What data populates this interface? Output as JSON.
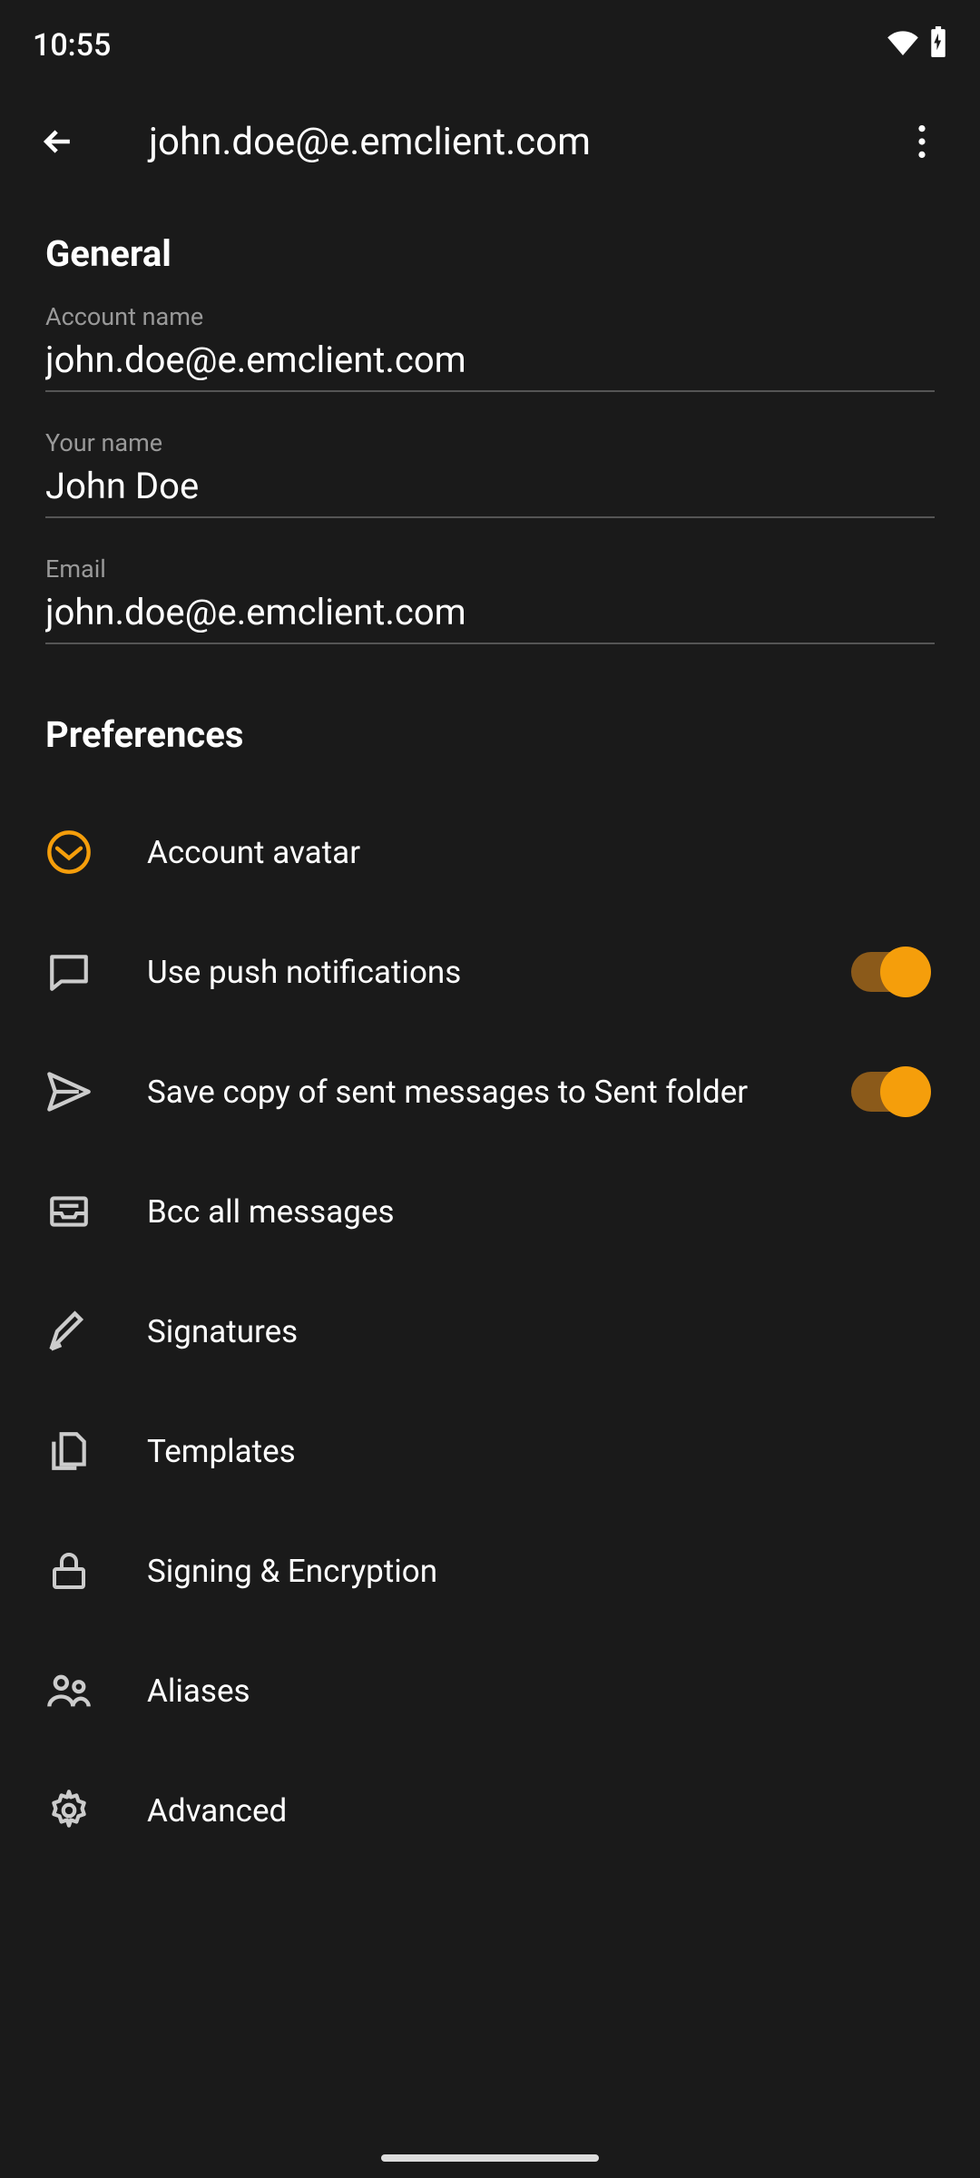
{
  "status": {
    "time": "10:55"
  },
  "header": {
    "title": "john.doe@e.emclient.com"
  },
  "general": {
    "section_title": "General",
    "account_name_label": "Account name",
    "account_name_value": "john.doe@e.emclient.com",
    "your_name_label": "Your name",
    "your_name_value": "John Doe",
    "email_label": "Email",
    "email_value": "john.doe@e.emclient.com"
  },
  "preferences": {
    "section_title": "Preferences",
    "items": {
      "avatar": "Account avatar",
      "push": "Use push notifications",
      "save_sent": "Save copy of sent messages to Sent folder",
      "bcc": "Bcc all messages",
      "signatures": "Signatures",
      "templates": "Templates",
      "signing": "Signing & Encryption",
      "aliases": "Aliases",
      "advanced": "Advanced"
    },
    "push_on": true,
    "save_sent_on": true
  },
  "colors": {
    "accent": "#f59e0b"
  }
}
